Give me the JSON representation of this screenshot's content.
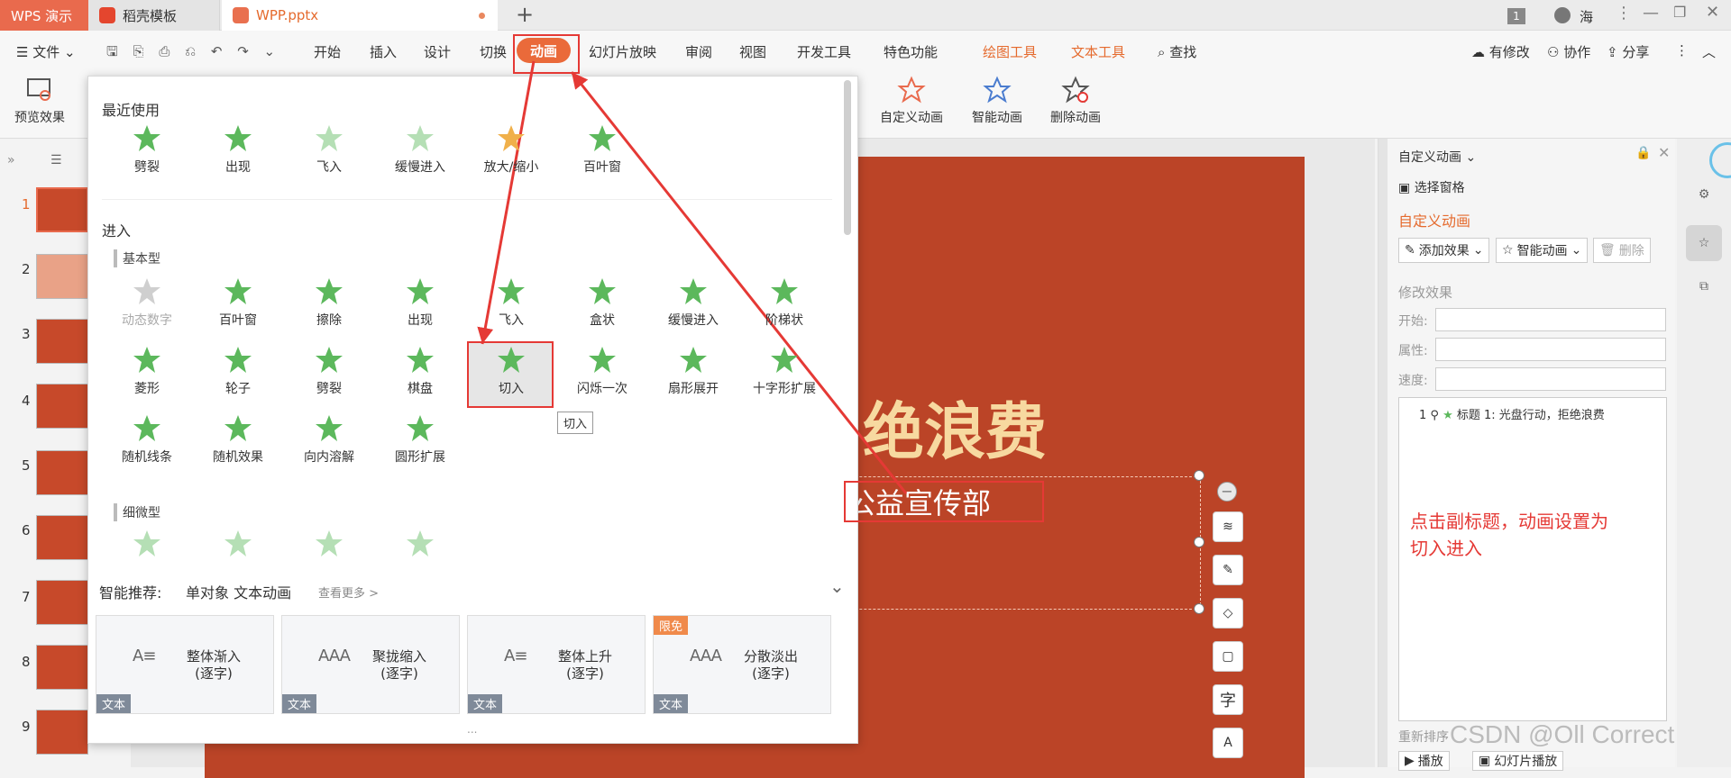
{
  "titlebar": {
    "app_tab": "WPS 演示",
    "tab2": "稻壳模板",
    "tab3": "WPP.pptx",
    "add_tab": "+",
    "badge": "1",
    "user": "海"
  },
  "menubar": {
    "file": "文件",
    "items": [
      "开始",
      "插入",
      "设计",
      "切换",
      "动画",
      "幻灯片放映",
      "审阅",
      "视图",
      "开发工具",
      "特色功能"
    ],
    "context": [
      "绘图工具",
      "文本工具"
    ],
    "search": "查找",
    "right": [
      "有修改",
      "协作",
      "分享"
    ]
  },
  "ribbon": {
    "preview": "预览效果",
    "custom": "自定义动画",
    "smart": "智能动画",
    "delete": "删除动画"
  },
  "dropdown": {
    "recent_title": "最近使用",
    "recent": [
      "劈裂",
      "出现",
      "飞入",
      "缓慢进入",
      "放大/缩小",
      "百叶窗"
    ],
    "enter_title": "进入",
    "basic_title": "基本型",
    "basic_row1": [
      "动态数字",
      "百叶窗",
      "擦除",
      "出现",
      "飞入",
      "盒状",
      "缓慢进入",
      "阶梯状"
    ],
    "basic_row2": [
      "菱形",
      "轮子",
      "劈裂",
      "棋盘",
      "切入",
      "闪烁一次",
      "扇形展开",
      "十字形扩展"
    ],
    "basic_row3": [
      "随机线条",
      "随机效果",
      "向内溶解",
      "圆形扩展"
    ],
    "tooltip": "切入",
    "subtle_title": "细微型",
    "smart_label": "智能推荐:",
    "smart_target": "单对象 文本动画",
    "see_more": "查看更多 >",
    "cards": [
      {
        "line1": "整体渐入",
        "line2": "(逐字)",
        "tag": "文本",
        "badge": ""
      },
      {
        "line1": "聚拢缩入",
        "line2": "(逐字)",
        "tag": "文本",
        "badge": ""
      },
      {
        "line1": "整体上升",
        "line2": "(逐字)",
        "tag": "文本",
        "badge": ""
      },
      {
        "line1": "分散淡出",
        "line2": "(逐字)",
        "tag": "文本",
        "badge": "限免"
      }
    ],
    "more": "..."
  },
  "thumbs": [
    "1",
    "2",
    "3",
    "4",
    "5",
    "6",
    "7",
    "8",
    "9"
  ],
  "slide": {
    "title_visible": "绝浪费",
    "subtitle_visible": "公益宣传部"
  },
  "rightpanel": {
    "header": "自定义动画",
    "select_pane": "选择窗格",
    "section": "自定义动画",
    "add_effect": "添加效果",
    "smart_anim": "智能动画",
    "delete": "删除",
    "modify": "修改效果",
    "start": "开始:",
    "property": "属性:",
    "speed": "速度:",
    "list_item_num": "1",
    "list_item": "标题 1: 光盘行动，拒绝浪费",
    "annotation_line1": "点击副标题，动画设置为",
    "annotation_line2": "切入进入",
    "reorder": "重新排序",
    "play": "播放",
    "slideshow": "幻灯片播放"
  },
  "watermark": "CSDN @Oll Correct",
  "colors": {
    "accent": "#ea6a3a",
    "slide_bg": "#bb4427",
    "star_green": "#5cb85c",
    "annotation": "#e53935",
    "title_text": "#f7d9a0"
  }
}
